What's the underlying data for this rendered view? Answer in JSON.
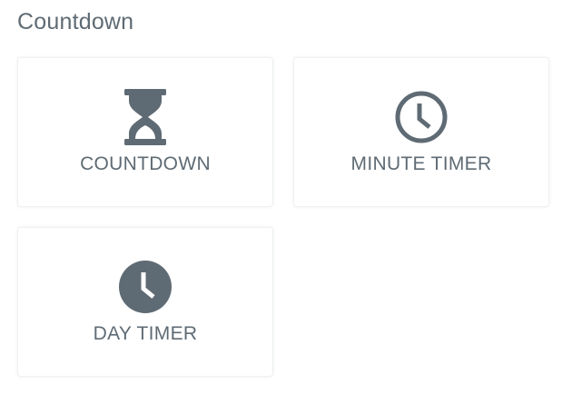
{
  "page": {
    "title": "Countdown"
  },
  "colors": {
    "text": "#5f6b74",
    "icon": "#5f6b74",
    "card_border": "#eef1f3",
    "background": "#ffffff"
  },
  "cards": [
    {
      "label": "COUNTDOWN",
      "icon": "hourglass-icon"
    },
    {
      "label": "MINUTE TIMER",
      "icon": "clock-outline-icon"
    },
    {
      "label": "DAY TIMER",
      "icon": "clock-filled-icon"
    }
  ]
}
